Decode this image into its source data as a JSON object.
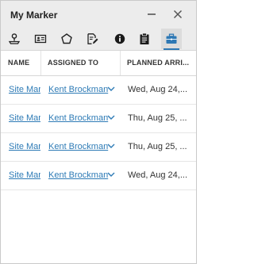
{
  "window": {
    "title": "My Marker"
  },
  "toolbar": {
    "tabs": [
      {
        "icon": "map-marker-icon"
      },
      {
        "icon": "id-card-icon"
      },
      {
        "icon": "pentagon-icon"
      },
      {
        "icon": "edit-document-icon"
      },
      {
        "icon": "info-icon"
      },
      {
        "icon": "clipboard-icon"
      },
      {
        "icon": "briefcase-icon",
        "active": true
      }
    ]
  },
  "table": {
    "headers": [
      "NAME",
      "ASSIGNED TO",
      "PLANNED ARRI..."
    ],
    "rows": [
      {
        "name": "Site Mar",
        "assigned_to": "Kent Brockman",
        "planned": "Wed, Aug 24,..."
      },
      {
        "name": "Site Mar",
        "assigned_to": "Kent Brockman",
        "planned": "Thu, Aug 25, ..."
      },
      {
        "name": "Site Mar",
        "assigned_to": "Kent Brockman",
        "planned": "Thu, Aug 25, ..."
      },
      {
        "name": "Site Mar",
        "assigned_to": "Kent Brockman",
        "planned": "Wed, Aug 24,..."
      }
    ]
  },
  "colors": {
    "link": "#2e7bb6",
    "accent": "#2e78b4",
    "titlebar_bg": "#ececec"
  }
}
